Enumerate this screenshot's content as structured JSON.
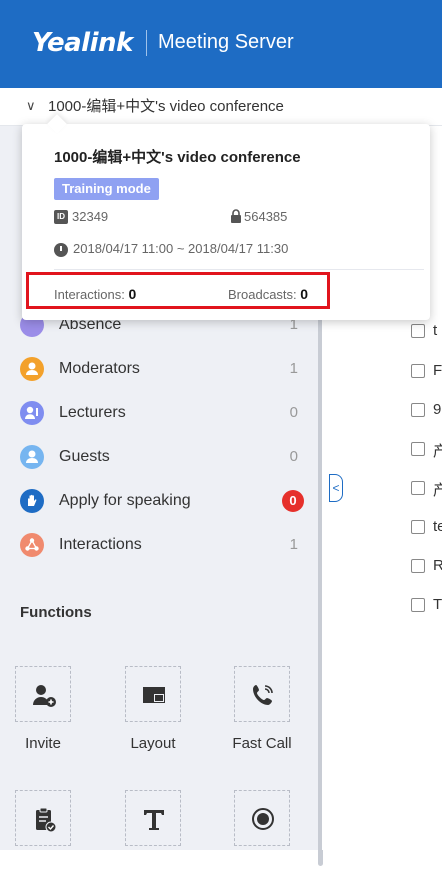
{
  "header": {
    "brand": "Yealink",
    "product": "Meeting Server"
  },
  "conference_bar": {
    "title": "1000-编辑+中文's video conference"
  },
  "popup": {
    "title": "1000-编辑+中文's video conference",
    "mode_badge": "Training mode",
    "id_label": "ID",
    "meeting_id": "32349",
    "password": "564385",
    "time_range": "2018/04/17 11:00 ~ 2018/04/17 11:30",
    "interactions_label": "Interactions:",
    "interactions_value": "0",
    "broadcasts_label": "Broadcasts:",
    "broadcasts_value": "0"
  },
  "categories": [
    {
      "label": "Absence",
      "count": "1",
      "color": "#9b8de8"
    },
    {
      "label": "Moderators",
      "count": "1",
      "color": "#f3a12b"
    },
    {
      "label": "Lecturers",
      "count": "0",
      "color": "#7f8df0"
    },
    {
      "label": "Guests",
      "count": "0",
      "color": "#76b5f0"
    },
    {
      "label": "Apply for speaking",
      "count": "0",
      "color": "#1e6cc4",
      "badge_color": "#e6302b"
    },
    {
      "label": "Interactions",
      "count": "1",
      "color": "#f08a6e"
    }
  ],
  "functions": {
    "title": "Functions",
    "items": [
      {
        "label": "Invite",
        "icon": "add-user-icon"
      },
      {
        "label": "Layout",
        "icon": "layout-icon"
      },
      {
        "label": "Fast Call",
        "icon": "phone-call-icon"
      },
      {
        "label": "",
        "icon": "clipboard-check-icon"
      },
      {
        "label": "",
        "icon": "text-icon"
      },
      {
        "label": "",
        "icon": "record-icon"
      }
    ]
  },
  "participant_list": [
    "t",
    "F",
    "9",
    "产",
    "产",
    "te",
    "R",
    "T"
  ]
}
